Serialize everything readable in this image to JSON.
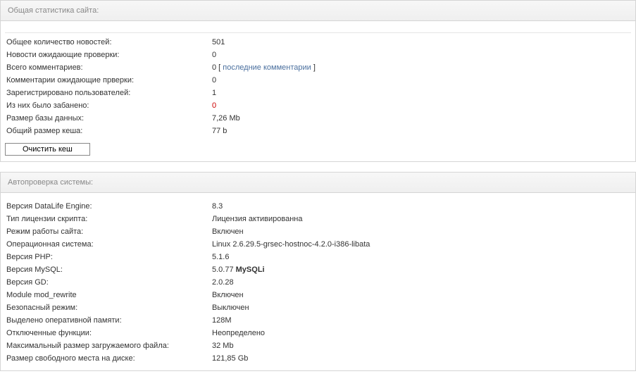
{
  "site_stats": {
    "title": "Общая статистика сайта:",
    "rows": [
      {
        "label": "Общее количество новостей:",
        "value": "501"
      },
      {
        "label": "Новости ожидающие проверки:",
        "value": "0"
      },
      {
        "label": "Всего комментариев:",
        "value": "0",
        "link_prefix": " [ ",
        "link_text": "последние комментарии",
        "link_suffix": " ]"
      },
      {
        "label": "Комментарии ожидающие прверки:",
        "value": "0"
      },
      {
        "label": "Зарегистрировано пользователей:",
        "value": "1"
      },
      {
        "label": "Из них было забанено:",
        "value": "0",
        "red": true
      },
      {
        "label": "Размер базы данных:",
        "value": "7,26 Mb"
      },
      {
        "label": "Общий размер кеша:",
        "value": "77 b"
      }
    ],
    "clear_cache_button": "Очистить кеш"
  },
  "system_check": {
    "title": "Автопроверка системы:",
    "rows": [
      {
        "label": "Версия DataLife Engine:",
        "value": "8.3"
      },
      {
        "label": "Тип лицензии скрипта:",
        "value": "Лицензия активированна"
      },
      {
        "label": "Режим работы сайта:",
        "value": "Включен"
      },
      {
        "label": "Операционная система:",
        "value": "Linux 2.6.29.5-grsec-hostnoc-4.2.0-i386-libata"
      },
      {
        "label": "Версия PHP:",
        "value": "5.1.6"
      },
      {
        "label": "Версия MySQL:",
        "value": "5.0.77 ",
        "bold_suffix": "MySQLi"
      },
      {
        "label": "Версия GD:",
        "value": "2.0.28"
      },
      {
        "label": "Module mod_rewrite",
        "value": "Включен"
      },
      {
        "label": "Безопасный режим:",
        "value": "Выключен"
      },
      {
        "label": "Выделено оперативной памяти:",
        "value": "128M"
      },
      {
        "label": "Отключенные функции:",
        "value": "Неопределено"
      },
      {
        "label": "Максимальный размер загружаемого файла:",
        "value": "32 Mb"
      },
      {
        "label": "Размер свободного места на диске:",
        "value": "121,85 Gb"
      }
    ]
  }
}
